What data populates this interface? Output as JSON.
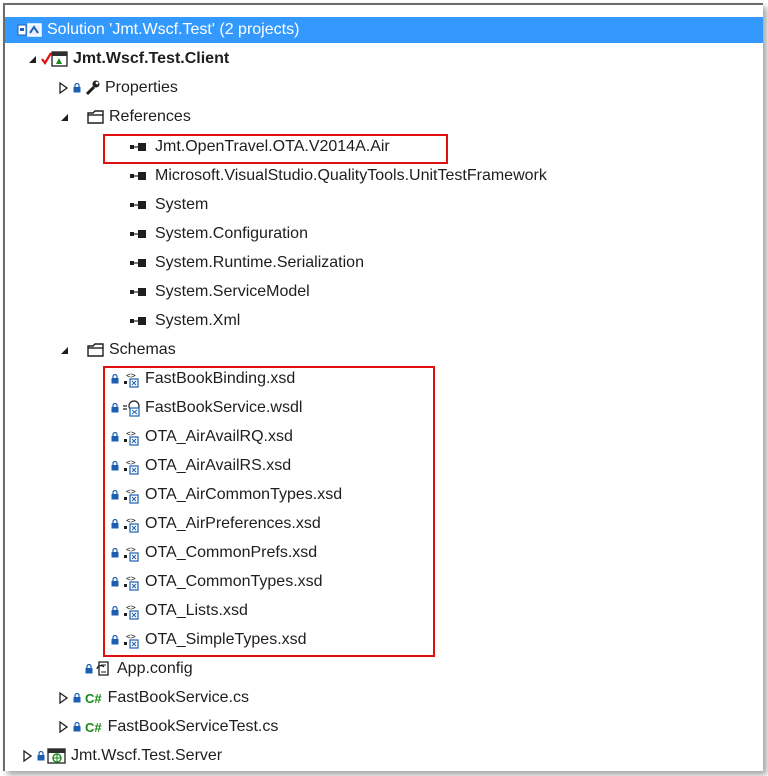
{
  "solution": {
    "label": "Solution 'Jmt.Wscf.Test' (2 projects)"
  },
  "client_project": {
    "label": "Jmt.Wscf.Test.Client"
  },
  "properties": {
    "label": "Properties"
  },
  "references": {
    "label": "References",
    "items": [
      "Jmt.OpenTravel.OTA.V2014A.Air",
      "Microsoft.VisualStudio.QualityTools.UnitTestFramework",
      "System",
      "System.Configuration",
      "System.Runtime.Serialization",
      "System.ServiceModel",
      "System.Xml"
    ]
  },
  "schemas": {
    "label": "Schemas",
    "items": [
      "FastBookBinding.xsd",
      "FastBookService.wsdl",
      "OTA_AirAvailRQ.xsd",
      "OTA_AirAvailRS.xsd",
      "OTA_AirCommonTypes.xsd",
      "OTA_AirPreferences.xsd",
      "OTA_CommonPrefs.xsd",
      "OTA_CommonTypes.xsd",
      "OTA_Lists.xsd",
      "OTA_SimpleTypes.xsd"
    ]
  },
  "app_config": {
    "label": "App.config"
  },
  "fastbook_service_cs": {
    "label": "FastBookService.cs",
    "icon_text": "C#"
  },
  "fastbook_service_test_cs": {
    "label": "FastBookServiceTest.cs",
    "icon_text": "C#"
  },
  "server_project": {
    "label": "Jmt.Wscf.Test.Server"
  },
  "colors": {
    "selection": "#3399ff",
    "highlight_box": "#e01010",
    "lock": "#1c5fb0",
    "csharp": "#1a8a1a"
  }
}
